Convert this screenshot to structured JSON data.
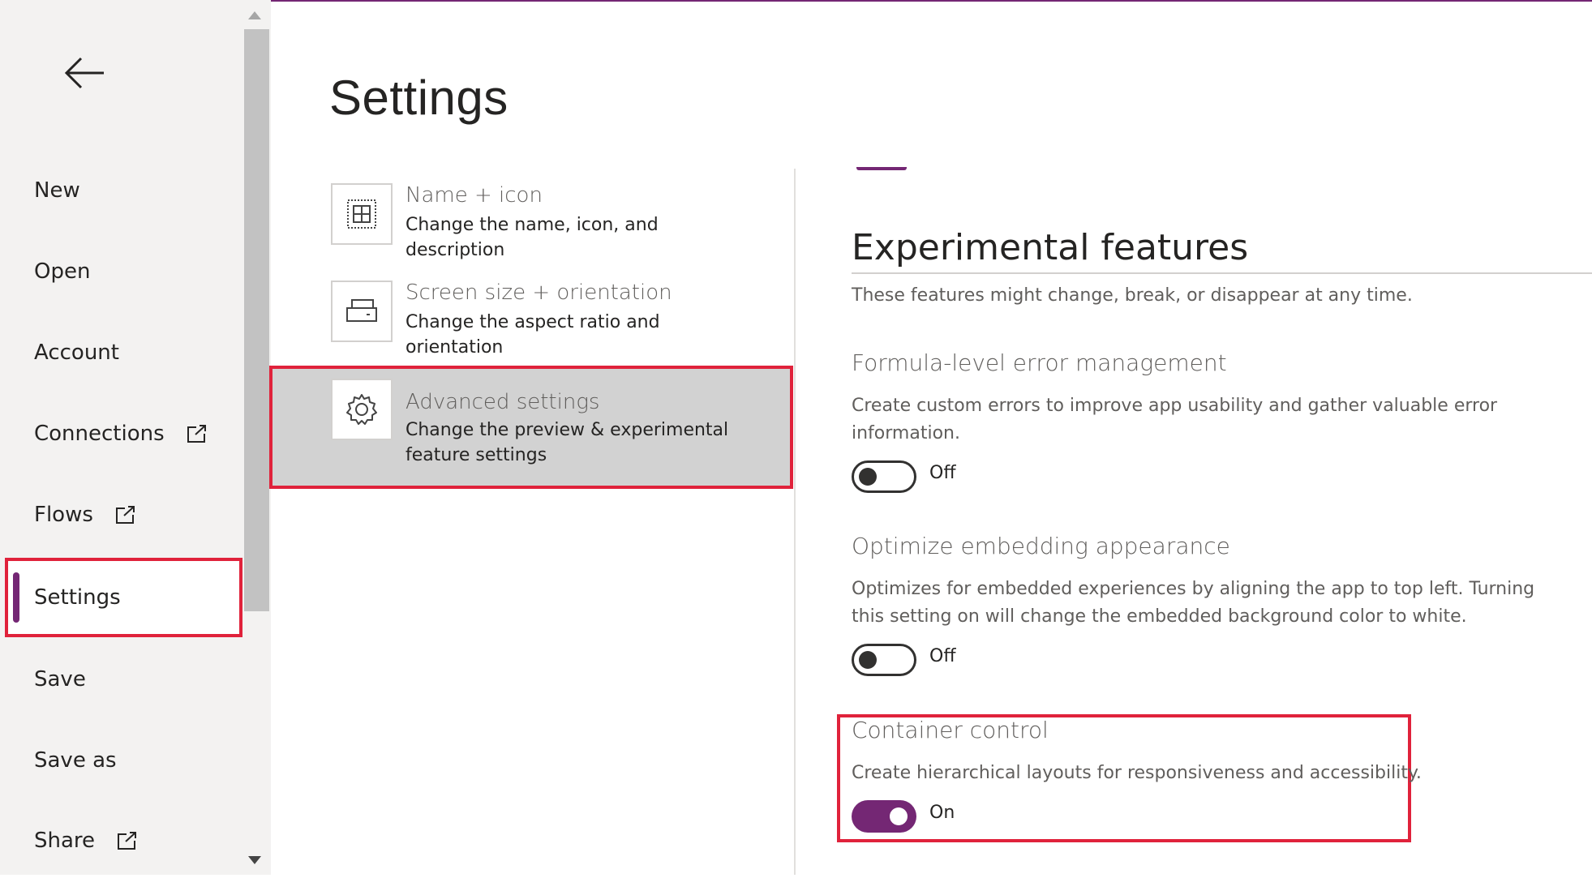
{
  "nav": {
    "back_icon": "arrow-left-icon",
    "items": [
      {
        "label": "New"
      },
      {
        "label": "Open"
      },
      {
        "label": "Account"
      },
      {
        "label": "Connections",
        "icon": "open-external-icon"
      },
      {
        "label": "Flows",
        "icon": "open-external-icon"
      },
      {
        "label": "Settings",
        "active": true
      },
      {
        "label": "Save"
      },
      {
        "label": "Save as"
      },
      {
        "label": "Share",
        "icon": "open-external-icon"
      }
    ]
  },
  "page": {
    "title": "Settings"
  },
  "categories": [
    {
      "title": "Name + icon",
      "description": "Change the name, icon, and description",
      "icon": "app-grid-icon"
    },
    {
      "title": "Screen size + orientation",
      "description": "Change the aspect ratio and orientation",
      "icon": "screen-orientation-icon"
    },
    {
      "title": "Advanced settings",
      "description": "Change the preview & experimental feature settings",
      "icon": "gear-icon",
      "selected": true
    }
  ],
  "section": {
    "title": "Experimental features",
    "subtitle": "These features might change, break, or disappear at any time."
  },
  "features": [
    {
      "title": "Formula-level error management",
      "description": "Create custom errors to improve app usability and gather valuable error information.",
      "state": "Off"
    },
    {
      "title": "Optimize embedding appearance",
      "description": "Optimizes for embedded experiences by aligning the app to top left. Turning this setting on will change the embedded background color to white.",
      "state": "Off"
    },
    {
      "title": "Container control",
      "description": "Create hierarchical layouts for responsiveness and accessibility.",
      "state": "On"
    }
  ],
  "colors": {
    "accent": "#742774",
    "highlight": "#e0223b",
    "nav_bg": "#f3f2f1",
    "selected_bg": "#d2d2d2"
  }
}
